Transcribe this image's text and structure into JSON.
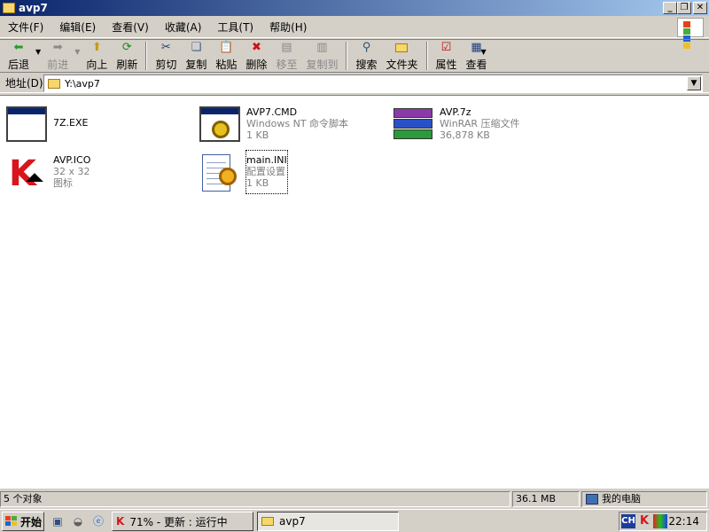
{
  "window": {
    "title": "avp7"
  },
  "menu": [
    "文件(F)",
    "编辑(E)",
    "查看(V)",
    "收藏(A)",
    "工具(T)",
    "帮助(H)"
  ],
  "toolbar": {
    "back": "后退",
    "forward": "前进",
    "up": "向上",
    "refresh": "刷新",
    "cut": "剪切",
    "copy": "复制",
    "paste": "粘贴",
    "delete": "删除",
    "move_to": "移至",
    "copy_to": "复制到",
    "search": "搜索",
    "folders": "文件夹",
    "properties": "属性",
    "views": "查看"
  },
  "address": {
    "label": "地址(D)",
    "value": "Y:\\avp7"
  },
  "files": [
    {
      "name": "7Z.EXE",
      "line2": "",
      "line3": ""
    },
    {
      "name": "AVP7.CMD",
      "line2": "Windows NT 命令脚本",
      "line3": "1 KB"
    },
    {
      "name": "AVP.7z",
      "line2": "WinRAR 压缩文件",
      "line3": "36,878 KB"
    },
    {
      "name": "AVP.ICO",
      "line2": "32 x 32",
      "line3": "图标"
    },
    {
      "name": "main.INI",
      "line2": "配置设置",
      "line3": "1 KB"
    }
  ],
  "status": {
    "count": "5 个对象",
    "size": "36.1 MB",
    "location": "我的电脑"
  },
  "taskbar": {
    "start": "开始",
    "tasks": [
      "71% - 更新 : 运行中",
      "avp7"
    ],
    "tray_lang": "CH",
    "clock": "22:14"
  },
  "colors": {
    "titlebar_start": "#0a246a",
    "titlebar_end": "#a6caf0",
    "face": "#d4d0c8"
  },
  "icons": [
    "folder-icon",
    "back-icon",
    "forward-icon",
    "up-icon",
    "refresh-icon",
    "cut-icon",
    "copy-icon",
    "paste-icon",
    "delete-icon",
    "move-icon",
    "copy-to-icon",
    "search-icon",
    "folders-icon",
    "properties-icon",
    "views-icon",
    "exe-icon",
    "cmd-icon",
    "rar-icon",
    "kaspersky-icon",
    "ini-icon"
  ]
}
